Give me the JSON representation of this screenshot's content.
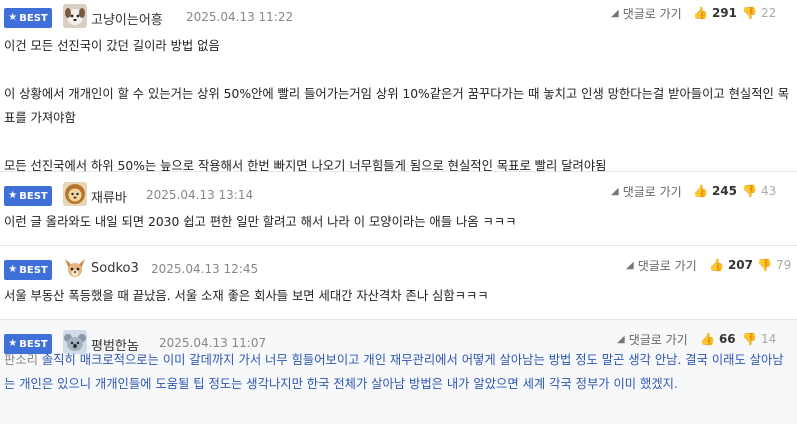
{
  "colors": {
    "badge": "#3f6fd8",
    "text": "#222222",
    "meta": "#888888",
    "highlight_text": "#2f56b4"
  },
  "comments": [
    {
      "badge": "BEST",
      "nickname": "고냥이는어흥",
      "date": "2025.04.13 11:22",
      "reply_label": "댓글로 가기",
      "likes": "291",
      "dislikes": "22",
      "avatar_icon": "puppy-avatar-icon",
      "lines": [
        "이건 모든 선진국이 갔던 길이라 방법 없음",
        "",
        "이 상황에서 개개인이 할 수 있는거는 상위 50%안에 빨리 들어가는거임 상위 10%같은거 꿈꾸다가는 때 놓치고 인생 망한다는걸 받아들이고 현실적인 목표를 가져야함",
        "",
        "모든 선진국에서 하위 50%는 늪으로 작용해서 한번 빠지면 나오기 너무힘들게 됨으로 현실적인 목표로 빨리 달려야됨"
      ]
    },
    {
      "badge": "BEST",
      "nickname": "재류바",
      "date": "2025.04.13 13:14",
      "reply_label": "댓글로 가기",
      "likes": "245",
      "dislikes": "43",
      "avatar_icon": "lion-avatar-icon",
      "lines": [
        "이런 글 올라와도 내일 되면 2030 쉽고 편한 일만 할려고 해서 나라 이 모양이라는 애들 나옴 ㅋㅋㅋ"
      ]
    },
    {
      "badge": "BEST",
      "nickname": "Sodko3",
      "date": "2025.04.13 12:45",
      "reply_label": "댓글로 가기",
      "likes": "207",
      "dislikes": "79",
      "avatar_icon": "chihuahua-avatar-icon",
      "lines": [
        "서울 부동산 폭등했을 때 끝났음. 서울 소재 좋은 회사들 보면 세대간 자산격차 존나 심함ㅋㅋㅋ"
      ]
    },
    {
      "badge": "BEST",
      "nickname": "평범한놈",
      "date": "2025.04.13 11:07",
      "reply_label": "댓글로 가기",
      "likes": "66",
      "dislikes": "14",
      "avatar_icon": "koala-avatar-icon",
      "prefix": "판소리",
      "lines": [
        "솔직히 매크로적으로는 이미 갈데까지 가서 너무 힘들어보이고 개인 재무관리에서 어떻게 살아남는 방법 정도 말곤 생각 안남. 결국 이래도 살아남는 개인은 있으니 개개인들에 도움될 팁 정도는 생각나지만 한국 전체가 살아남 방법은 내가 알았으면 세계 각국 정부가 이미 했겠지."
      ]
    }
  ]
}
